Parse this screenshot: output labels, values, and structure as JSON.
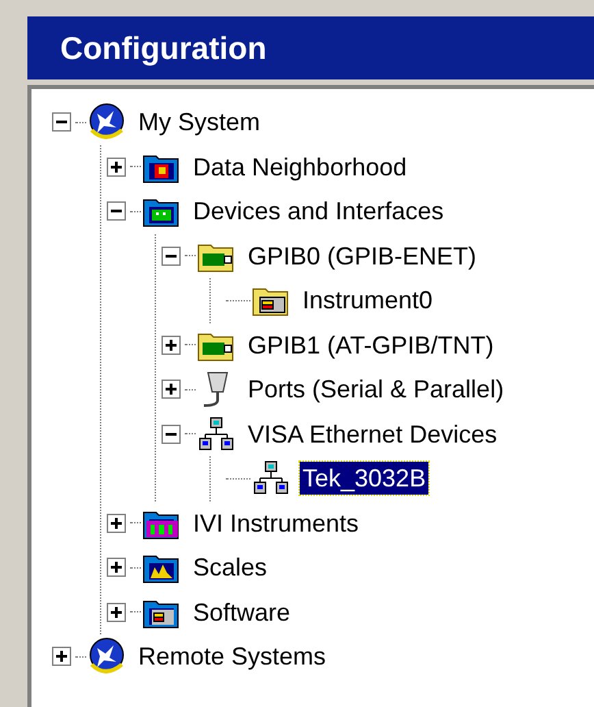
{
  "title": "Configuration",
  "tree": [
    {
      "label": "My System",
      "kind": "system",
      "expanded": true,
      "selected": false,
      "children": [
        {
          "label": "Data Neighborhood",
          "kind": "data-folder",
          "expanded": false,
          "selected": false
        },
        {
          "label": "Devices and Interfaces",
          "kind": "device-folder",
          "expanded": true,
          "selected": false,
          "children": [
            {
              "label": "GPIB0 (GPIB-ENET)",
              "kind": "card",
              "expanded": true,
              "selected": false,
              "children": [
                {
                  "label": "Instrument0",
                  "kind": "instrument",
                  "selected": false
                }
              ]
            },
            {
              "label": "GPIB1 (AT-GPIB/TNT)",
              "kind": "card",
              "expanded": false,
              "selected": false
            },
            {
              "label": "Ports (Serial & Parallel)",
              "kind": "port",
              "expanded": false,
              "selected": false
            },
            {
              "label": "VISA Ethernet Devices",
              "kind": "network",
              "expanded": true,
              "selected": false,
              "children": [
                {
                  "label": "Tek_3032B",
                  "kind": "network",
                  "selected": true
                }
              ]
            }
          ]
        },
        {
          "label": "IVI Instruments",
          "kind": "ivi-folder",
          "expanded": false,
          "selected": false
        },
        {
          "label": "Scales",
          "kind": "scales-folder",
          "expanded": false,
          "selected": false
        },
        {
          "label": "Software",
          "kind": "software-folder",
          "expanded": false,
          "selected": false
        }
      ]
    },
    {
      "label": "Remote Systems",
      "kind": "system",
      "expanded": false,
      "selected": false
    }
  ]
}
